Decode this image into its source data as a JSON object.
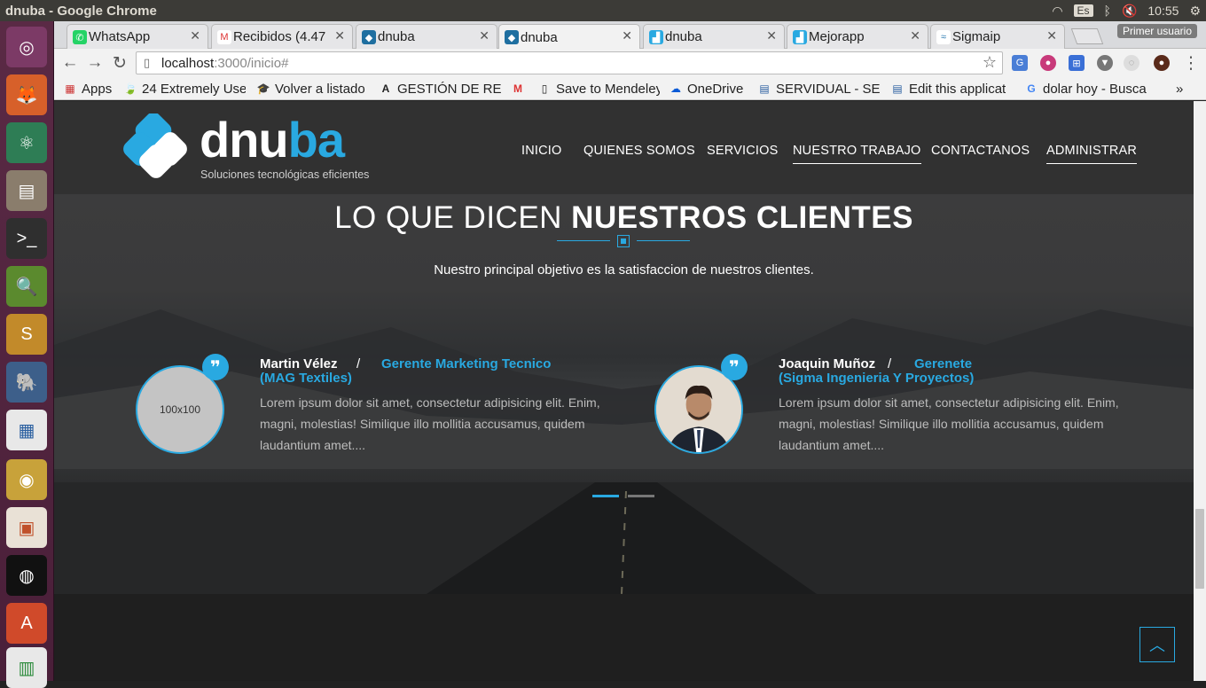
{
  "os": {
    "window_title": "dnuba - Google Chrome",
    "keyboard_lang": "Es",
    "clock": "10:55"
  },
  "tabs": [
    {
      "label": "WhatsApp",
      "icon": "whatsapp-icon"
    },
    {
      "label": "Recibidos (4.47",
      "icon": "gmail-icon"
    },
    {
      "label": "dnuba",
      "icon": "dnuba-icon"
    },
    {
      "label": "dnuba",
      "icon": "dnuba-icon",
      "active": true
    },
    {
      "label": "dnuba",
      "icon": "chart-icon"
    },
    {
      "label": "Mejorapp",
      "icon": "chart-icon"
    },
    {
      "label": "Sigmaip",
      "icon": "sigmaip-icon"
    }
  ],
  "profile_button": "Primer usuario",
  "address": {
    "host": "localhost",
    "path": ":3000/inicio#"
  },
  "bookmarks": [
    {
      "label": "Apps"
    },
    {
      "label": "24 Extremely Use"
    },
    {
      "label": "Volver a listado"
    },
    {
      "label": "GESTIÓN DE REC"
    },
    {
      "label": ""
    },
    {
      "label": "Save to Mendeley"
    },
    {
      "label": "OneDrive"
    },
    {
      "label": "SERVIDUAL - SER"
    },
    {
      "label": "Edit this applicat"
    },
    {
      "label": "dolar hoy - Busca"
    }
  ],
  "site": {
    "logo_text_1": "d",
    "logo_text_2": "nu",
    "logo_text_3": "ba",
    "tagline": "Soluciones tecnológicas eficientes",
    "menu": [
      "INICIO",
      "QUIENES SOMOS",
      "SERVICIOS",
      "NUESTRO TRABAJO",
      "CONTACTANOS",
      "ADMINISTRAR"
    ],
    "section_title_light": "LO QUE DICEN ",
    "section_title_bold": "NUESTROS CLIENTES",
    "section_subtitle": "Nuestro principal objetivo es la satisfaccion de nuestros clientes.",
    "testimonials": [
      {
        "name": "Martin Vélez",
        "role": "Gerente Marketing Tecnico",
        "company": "(MAG Textiles)",
        "avatar_placeholder": "100x100",
        "text": "Lorem ipsum dolor sit amet, consectetur adipisicing elit. Enim, magni, molestias! Similique illo mollitia accusamus, quidem laudantium amet...."
      },
      {
        "name": "Joaquin Muñoz",
        "role": "Gerenete",
        "company": "(Sigma Ingenieria Y Proyectos)",
        "text": "Lorem ipsum dolor sit amet, consectetur adipisicing elit. Enim, magni, molestias! Similique illo mollitia accusamus, quidem laudantium amet...."
      }
    ],
    "slash": "/",
    "quote_glyph": "❞"
  }
}
